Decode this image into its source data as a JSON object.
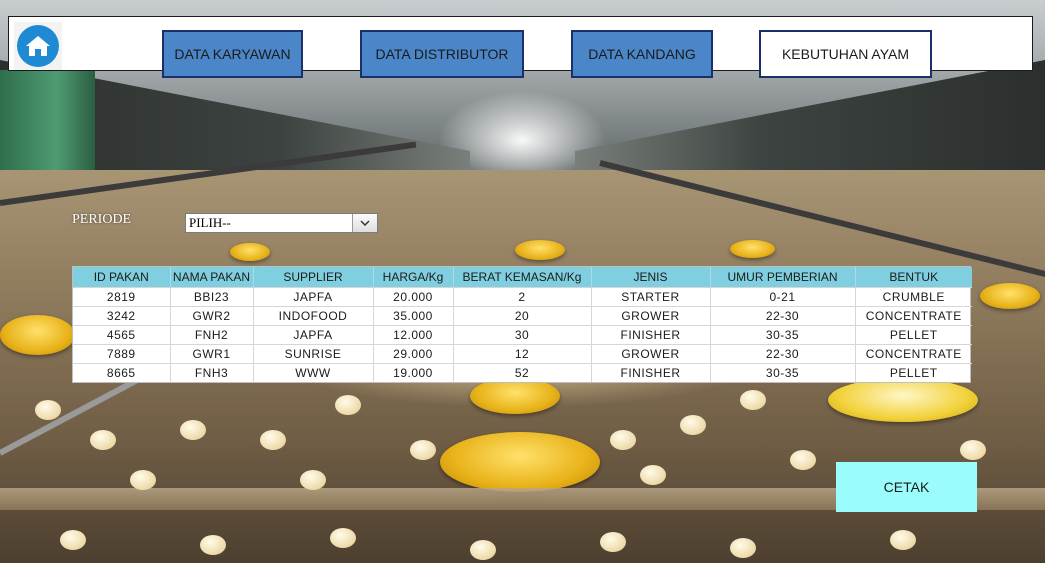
{
  "nav": {
    "home_icon": "home-icon",
    "items": [
      {
        "label": "DATA KARYAWAN"
      },
      {
        "label": "DATA DISTRIBUTOR"
      },
      {
        "label": "DATA KANDANG"
      },
      {
        "label": "KEBUTUHAN AYAM"
      }
    ]
  },
  "periode": {
    "label": "PERIODE",
    "selected": "PILIH--"
  },
  "table": {
    "headers": [
      "ID PAKAN",
      "NAMA PAKAN",
      "SUPPLIER",
      "HARGA/Kg",
      "BERAT KEMASAN/Kg",
      "JENIS",
      "UMUR PEMBERIAN",
      "BENTUK"
    ],
    "rows": [
      [
        "2819",
        "BBI23",
        "JAPFA",
        "20.000",
        "2",
        "STARTER",
        "0-21",
        "CRUMBLE"
      ],
      [
        "3242",
        "GWR2",
        "INDOFOOD",
        "35.000",
        "20",
        "GROWER",
        "22-30",
        "CONCENTRATE"
      ],
      [
        "4565",
        "FNH2",
        "JAPFA",
        "12.000",
        "30",
        "FINISHER",
        "30-35",
        "PELLET"
      ],
      [
        "7889",
        "GWR1",
        "SUNRISE",
        "29.000",
        "12",
        "GROWER",
        "22-30",
        "CONCENTRATE"
      ],
      [
        "8665",
        "FNH3",
        "WWW",
        "19.000",
        "52",
        "FINISHER",
        "30-35",
        "PELLET"
      ]
    ]
  },
  "actions": {
    "print_label": "CETAK"
  },
  "colors": {
    "nav_blue": "#4a86c8",
    "nav_border": "#1b2f6a",
    "table_header": "#7fcfe0",
    "print_button": "#9bfcfc",
    "home_icon_bg": "#1e8ad3"
  }
}
